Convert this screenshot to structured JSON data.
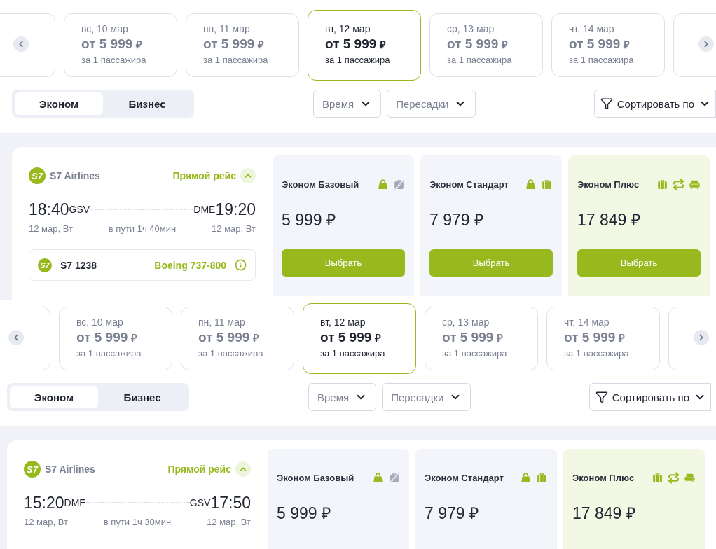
{
  "panels": [
    {
      "dates": [
        {
          "day": "вс, 10 мар",
          "price": "от 5 999",
          "currency": "₽",
          "note": "за 1 пассажира",
          "selected": false
        },
        {
          "day": "пн, 11 мар",
          "price": "от 5 999",
          "currency": "₽",
          "note": "за 1 пассажира",
          "selected": false
        },
        {
          "day": "вт, 12 мар",
          "price": "от 5 999",
          "currency": "₽",
          "note": "за 1 пассажира",
          "selected": true
        },
        {
          "day": "ср, 13 мар",
          "price": "от 5 999",
          "currency": "₽",
          "note": "за 1 пассажира",
          "selected": false
        },
        {
          "day": "чт, 14 мар",
          "price": "от 5 999",
          "currency": "₽",
          "note": "за 1 пассажира",
          "selected": false
        }
      ],
      "classes": [
        {
          "label": "Эконом",
          "selected": true
        },
        {
          "label": "Бизнес",
          "selected": false
        }
      ],
      "filters": [
        {
          "label": "Время"
        },
        {
          "label": "Пересадки"
        }
      ],
      "sort": {
        "label": "Сортировать по"
      },
      "flight": {
        "logo_text": "S7",
        "airline": "S7 Airlines",
        "direct_label": "Прямой рейс",
        "expanded": true,
        "departure": {
          "time": "18:40",
          "airport": "GSV",
          "date": "12 мар, Вт"
        },
        "arrival": {
          "time": "19:20",
          "airport": "DME",
          "date": "12 мар, Вт"
        },
        "duration": "в пути 1ч 40мин",
        "number_logo_text": "S7",
        "flight_number": "S7 1238",
        "aircraft": "Boeing 737-800",
        "fares": [
          {
            "name": "Эконом Базовый",
            "price": "5 999 ₽",
            "highlighted": false,
            "button": "Выбрать",
            "icons": [
              {
                "kind": "hand_bag",
                "included": true
              },
              {
                "kind": "suitcase",
                "included": false
              }
            ]
          },
          {
            "name": "Эконом Стандарт",
            "price": "7 979 ₽",
            "highlighted": false,
            "button": "Выбрать",
            "icons": [
              {
                "kind": "hand_bag",
                "included": true
              },
              {
                "kind": "suitcase",
                "included": true
              }
            ]
          },
          {
            "name": "Эконом Плюс",
            "price": "17 849 ₽",
            "highlighted": true,
            "button": "Выбрать",
            "icons": [
              {
                "kind": "suitcase",
                "included": true
              },
              {
                "kind": "exchange",
                "included": true
              },
              {
                "kind": "seat",
                "included": true
              }
            ]
          }
        ]
      }
    },
    {
      "dates": [
        {
          "day": "вс, 10 мар",
          "price": "от 5 999",
          "currency": "₽",
          "note": "за 1 пассажира",
          "selected": false
        },
        {
          "day": "пн, 11 мар",
          "price": "от 5 999",
          "currency": "₽",
          "note": "за 1 пассажира",
          "selected": false
        },
        {
          "day": "вт, 12 мар",
          "price": "от 5 999",
          "currency": "₽",
          "note": "за 1 пассажира",
          "selected": true
        },
        {
          "day": "ср, 13 мар",
          "price": "от 5 999",
          "currency": "₽",
          "note": "за 1 пассажира",
          "selected": false
        },
        {
          "day": "чт, 14 мар",
          "price": "от 5 999",
          "currency": "₽",
          "note": "за 1 пассажира",
          "selected": false
        }
      ],
      "classes": [
        {
          "label": "Эконом",
          "selected": true
        },
        {
          "label": "Бизнес",
          "selected": false
        }
      ],
      "filters": [
        {
          "label": "Время"
        },
        {
          "label": "Пересадки"
        }
      ],
      "sort": {
        "label": "Сортировать по"
      },
      "flight": {
        "logo_text": "S7",
        "airline": "S7 Airlines",
        "direct_label": "Прямой рейс",
        "expanded": true,
        "departure": {
          "time": "15:20",
          "airport": "DME",
          "date": "12 мар, Вт"
        },
        "arrival": {
          "time": "17:50",
          "airport": "GSV",
          "date": "12 мар, Вт"
        },
        "duration": "в пути 1ч 30мин",
        "fares": [
          {
            "name": "Эконом Базовый",
            "price": "5 999 ₽",
            "highlighted": false,
            "icons": [
              {
                "kind": "hand_bag",
                "included": true
              },
              {
                "kind": "suitcase",
                "included": false
              }
            ]
          },
          {
            "name": "Эконом Стандарт",
            "price": "7 979 ₽",
            "highlighted": false,
            "icons": [
              {
                "kind": "hand_bag",
                "included": true
              },
              {
                "kind": "suitcase",
                "included": true
              }
            ]
          },
          {
            "name": "Эконом Плюс",
            "price": "17 849 ₽",
            "highlighted": true,
            "icons": [
              {
                "kind": "suitcase",
                "included": true
              },
              {
                "kind": "exchange",
                "included": true
              },
              {
                "kind": "seat",
                "included": true
              }
            ]
          }
        ]
      }
    }
  ]
}
